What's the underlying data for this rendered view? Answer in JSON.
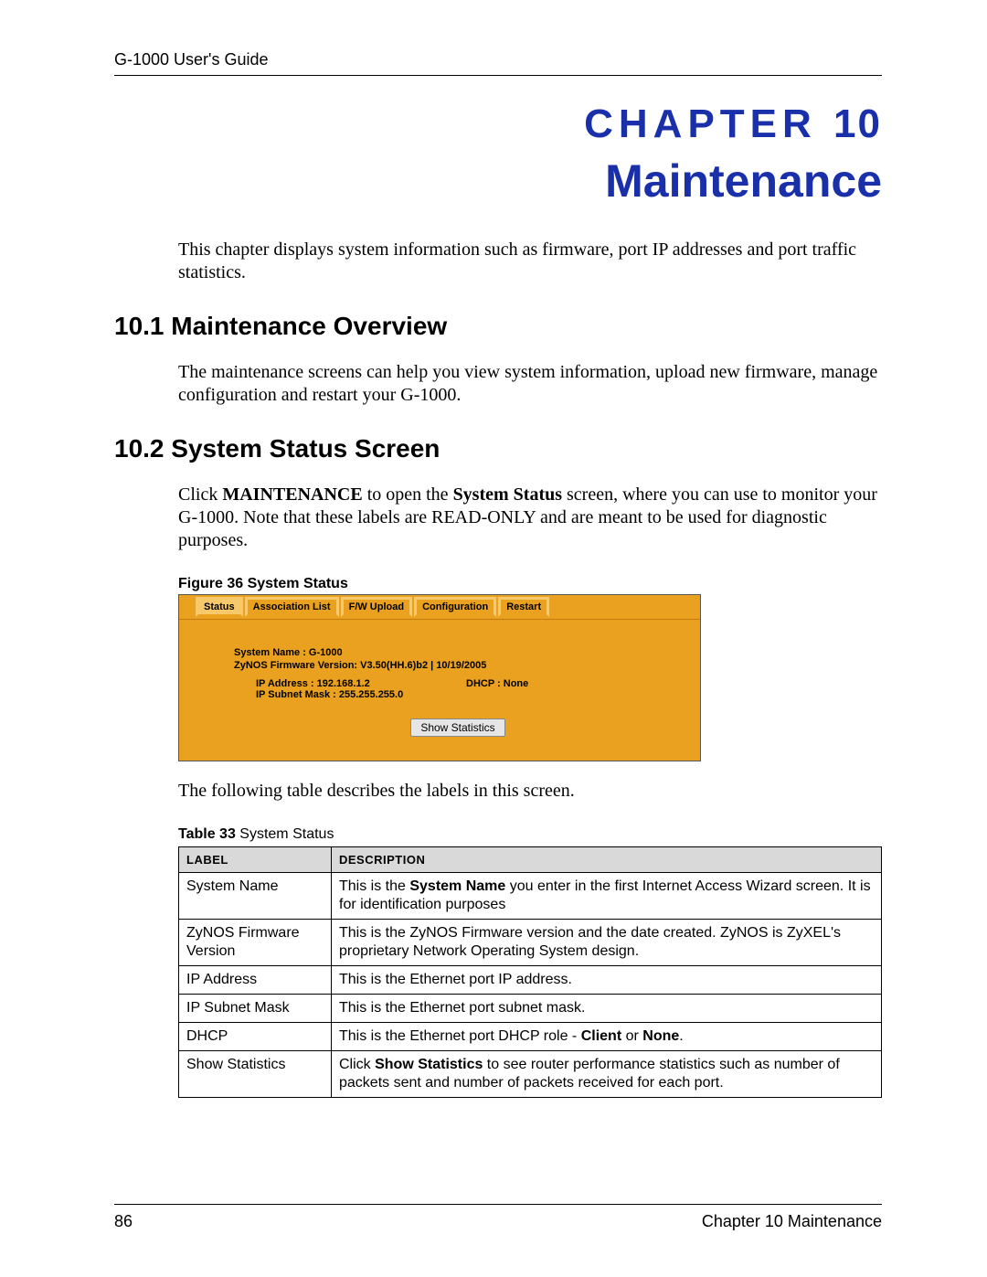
{
  "header": {
    "guide": "G-1000 User's Guide"
  },
  "chapter": {
    "label_word": "CHAPTER",
    "number": "10",
    "title": "Maintenance",
    "intro": "This chapter displays system information such as firmware, port IP addresses and port traffic statistics."
  },
  "sections": {
    "s1": {
      "heading": "10.1  Maintenance Overview",
      "body": "The maintenance screens can help you view system information, upload new firmware, manage configuration and restart your G-1000."
    },
    "s2": {
      "heading": "10.2  System Status Screen",
      "body_pre": "Click ",
      "body_b1": "MAINTENANCE",
      "body_mid1": " to open the ",
      "body_b2": "System Status",
      "body_post": " screen, where you can use to monitor your G-1000. Note that these labels are READ-ONLY and are meant to be used for diagnostic purposes."
    }
  },
  "figure": {
    "caption": "Figure 36   System Status",
    "tabs": [
      "Status",
      "Association List",
      "F/W Upload",
      "Configuration",
      "Restart"
    ],
    "system_name": "System Name : G-1000",
    "fw": "ZyNOS Firmware Version: V3.50(HH.6)b2 | 10/19/2005",
    "ip": "IP Address : 192.168.1.2",
    "dhcp": "DHCP : None",
    "mask": "IP Subnet Mask : 255.255.255.0",
    "button": "Show Statistics"
  },
  "after_figure": "The following table describes the labels in this screen.",
  "table": {
    "caption_b": "Table 33",
    "caption_rest": "   System Status",
    "head_label": "LABEL",
    "head_desc": "DESCRIPTION",
    "rows": [
      {
        "label": "System Name",
        "desc_pre": "This is the ",
        "desc_b": "System Name",
        "desc_post": " you enter in the first Internet Access Wizard screen. It is for identification purposes"
      },
      {
        "label": "ZyNOS Firmware Version",
        "desc": "This is the ZyNOS Firmware version and the date created. ZyNOS is ZyXEL's proprietary Network Operating System design."
      },
      {
        "label": "IP Address",
        "desc": "This is the Ethernet port IP address."
      },
      {
        "label": "IP Subnet Mask",
        "desc": "This is the Ethernet port subnet mask."
      },
      {
        "label": "DHCP",
        "desc_pre": "This is the Ethernet port DHCP role - ",
        "desc_b": "Client",
        "desc_mid": " or ",
        "desc_b2": "None",
        "desc_post": "."
      },
      {
        "label": "Show Statistics",
        "desc_pre": "Click ",
        "desc_b": "Show Statistics",
        "desc_post": " to see router performance statistics such as number of packets sent and number of packets received for each port."
      }
    ]
  },
  "footer": {
    "page": "86",
    "right": "Chapter 10 Maintenance"
  }
}
